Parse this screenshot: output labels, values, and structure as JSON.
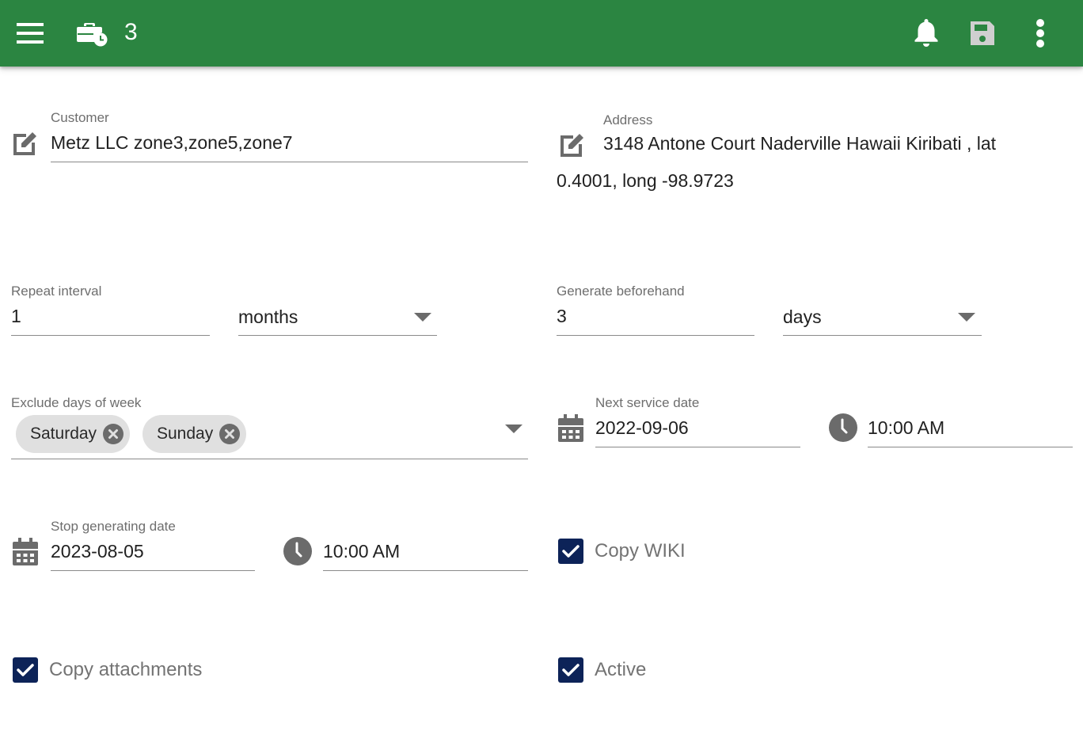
{
  "appbar": {
    "menu_icon": "menu-icon",
    "jobs_icon": "briefcase-clock-icon",
    "count": "3",
    "notifications_icon": "bell-icon",
    "save_icon": "floppy-disk-icon",
    "more_icon": "more-vert-icon",
    "colors": {
      "background": "#2b8541",
      "save_disabled": "#cfcfcf"
    }
  },
  "form": {
    "customer": {
      "label": "Customer",
      "value": "Metz LLC zone3,zone5,zone7",
      "icon": "edit-icon"
    },
    "address": {
      "label": "Address",
      "value_line1": "3148 Antone Court Naderville Hawaii Kiribati , lat",
      "value_line2": "0.4001, long -98.9723",
      "icon": "edit-icon"
    },
    "repeat_interval": {
      "label": "Repeat interval",
      "value": "1",
      "unit": "months"
    },
    "generate_beforehand": {
      "label": "Generate beforehand",
      "value": "3",
      "unit": "days"
    },
    "exclude_days": {
      "label": "Exclude days of week",
      "chips": [
        "Saturday",
        "Sunday"
      ]
    },
    "next_service": {
      "label": "Next service date",
      "date": "2022-09-06",
      "time": "10:00 AM"
    },
    "stop_generating": {
      "label": "Stop generating date",
      "date": "2023-08-05",
      "time": "10:00 AM"
    },
    "checkboxes": {
      "copy_wiki": {
        "label": "Copy WIKI",
        "checked": true
      },
      "copy_attachments": {
        "label": "Copy attachments",
        "checked": true
      },
      "active": {
        "label": "Active",
        "checked": true
      }
    },
    "colors": {
      "checkbox": "#0d2358",
      "icon_gray": "#6b6b6b",
      "underline": "#8a8a8a",
      "chip_bg": "#e0e0e0"
    }
  }
}
